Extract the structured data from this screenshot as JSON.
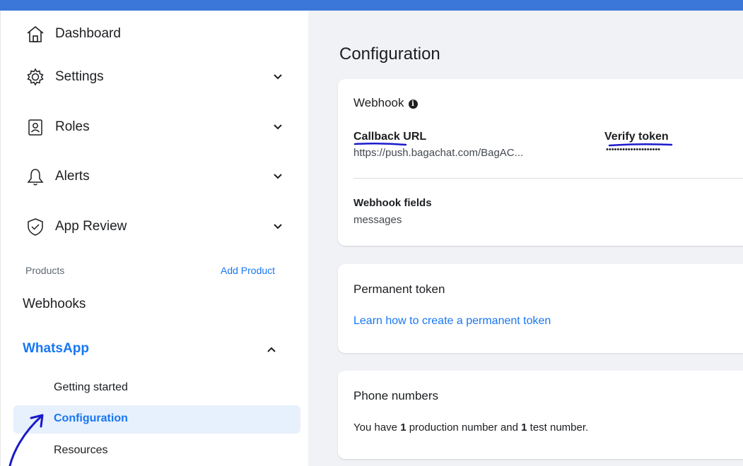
{
  "sidebar": {
    "items": [
      {
        "label": "Dashboard",
        "icon": "home-icon"
      },
      {
        "label": "Settings",
        "icon": "gear-icon"
      },
      {
        "label": "Roles",
        "icon": "id-badge-icon"
      },
      {
        "label": "Alerts",
        "icon": "bell-icon"
      },
      {
        "label": "App Review",
        "icon": "check-shield-icon"
      }
    ],
    "products_label": "Products",
    "add_product_label": "Add Product",
    "webhooks_label": "Webhooks",
    "whatsapp_label": "WhatsApp",
    "whatsapp_sub": {
      "getting_started": "Getting started",
      "configuration": "Configuration",
      "resources": "Resources"
    }
  },
  "main": {
    "title": "Configuration",
    "webhook_card": {
      "title": "Webhook",
      "callback_url_label": "Callback URL",
      "callback_url_value": "https://push.bagachat.com/BagAC...",
      "verify_token_label": "Verify token",
      "verify_token_value": "••••••••••••••••••••",
      "fields_label": "Webhook fields",
      "fields_value": "messages"
    },
    "permanent_token_card": {
      "title": "Permanent token",
      "link": "Learn how to create a permanent token"
    },
    "phone_numbers_card": {
      "title": "Phone numbers",
      "text_1": "You have ",
      "production_count": "1",
      "text_2": " production number and ",
      "test_count": "1",
      "text_3": " test number."
    }
  },
  "colors": {
    "accent": "#1877f2",
    "topbar": "#3a77d8",
    "active_bg": "#e7f0fd",
    "annotation": "#1a1acc"
  }
}
